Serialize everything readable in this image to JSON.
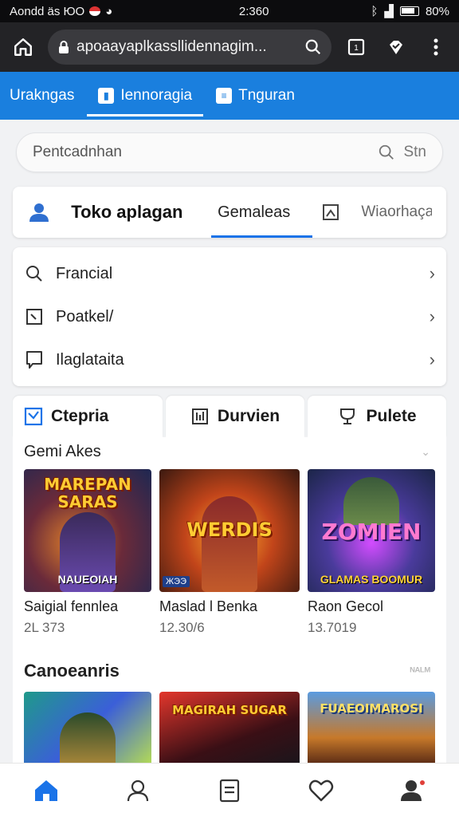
{
  "status_bar": {
    "left_text": "Aondd äs ЮО",
    "time": "2:360",
    "battery": "80%"
  },
  "browser": {
    "url": "apoaayaplkassllidennagim..."
  },
  "top_tabs": [
    {
      "label": "Urakngas"
    },
    {
      "label": "Iennoragia"
    },
    {
      "label": "Tnguran"
    }
  ],
  "search": {
    "placeholder": "Pentcadnhan",
    "action_label": "Stn"
  },
  "section_tabs": {
    "store": "Toko aplagan",
    "games": "Gemaleas",
    "wishlist": "Wiaorhaça"
  },
  "menu_list": [
    {
      "label": "Francial"
    },
    {
      "label": "Poatkel/"
    },
    {
      "label": "Ilaglataita"
    }
  ],
  "category_tabs": [
    {
      "label": "Ctepria"
    },
    {
      "label": "Durvien"
    },
    {
      "label": "Pulete"
    }
  ],
  "section1": {
    "title": "Gemi Akes",
    "games": [
      {
        "art_title": "MAREPAN SARAS",
        "art_sub": "NAUEOIAH",
        "name": "Saigial fennlea",
        "count": "2L 373"
      },
      {
        "art_title": "WERDIS",
        "art_tag": "ЖЭЭ",
        "name": "Maslad l Benka",
        "count": "12.30/6"
      },
      {
        "art_title": "ZOMIEN",
        "art_sub": "GLAMAS BOOMUR",
        "name": "Raon Gecol",
        "count": "13.7019"
      }
    ]
  },
  "section2": {
    "title": "Canoeanris",
    "more": "ᴺᴬᴸᴹ",
    "games": [
      {
        "art_title": ""
      },
      {
        "art_title": "MAGIRAH SUGAR"
      },
      {
        "art_title": "FUAEOIMAROSI"
      }
    ]
  }
}
